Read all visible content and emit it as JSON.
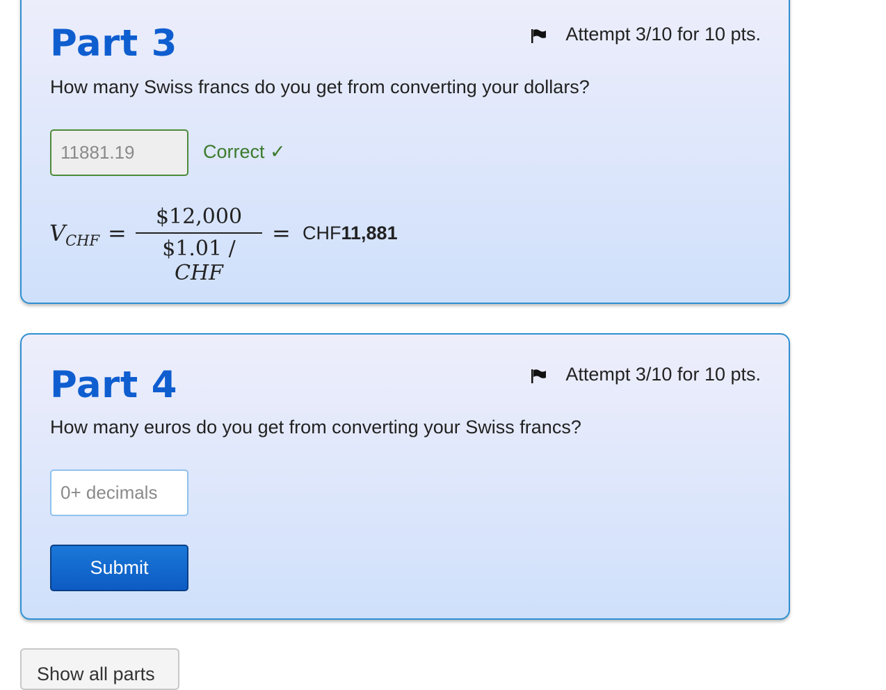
{
  "part3": {
    "title": "Part 3",
    "attempt": "Attempt 3/10 for 10 pts.",
    "question": "How many Swiss francs do you get from converting your dollars?",
    "answer_value": "11881.19",
    "feedback": "Correct ✓",
    "math": {
      "variable": "V",
      "subscript": "CHF",
      "equals": "=",
      "numerator": "$12,000",
      "denominator_value": "$1.01",
      "denominator_sep": " / ",
      "denominator_unit": "CHF",
      "result_prefix": "CHF",
      "result_value": "11,881"
    }
  },
  "part4": {
    "title": "Part 4",
    "attempt": "Attempt 3/10 for 10 pts.",
    "question": "How many euros do you get from converting your Swiss francs?",
    "answer_placeholder": "0+ decimals",
    "submit_label": "Submit"
  },
  "footer": {
    "show_all_label": "Show all parts"
  },
  "icons": {
    "attempt_flag": "flag-icon"
  },
  "colors": {
    "title_blue": "#0f5ed0",
    "card_border": "#2f8fd0",
    "correct_green": "#3b7a2c",
    "submit_blue": "#0d5bc4"
  }
}
